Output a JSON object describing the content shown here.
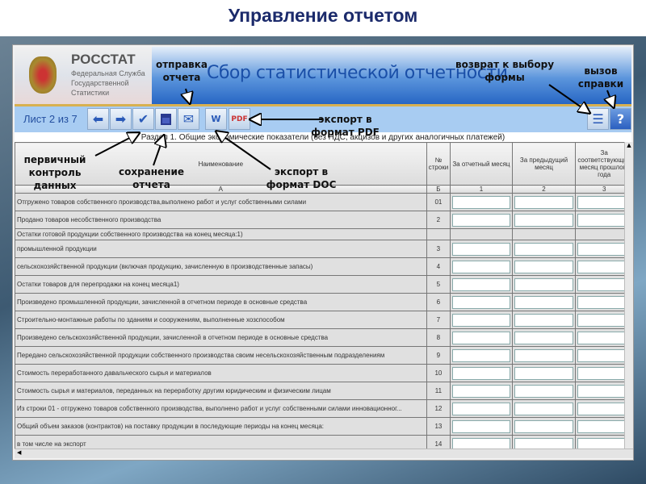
{
  "slide_title": "Управление отчетом",
  "logo": {
    "name": "РОССТАТ",
    "subtitle": "Федеральная Служба Государственной Статистики"
  },
  "app_title": "Сбор статистической отчетности",
  "toolbar": {
    "sheet": "Лист 2 из 7",
    "buttons": [
      "prev-arrow",
      "next-arrow",
      "check",
      "save",
      "mail",
      "export-doc",
      "export-pdf",
      "return-form",
      "help"
    ]
  },
  "section_title": "Раздел 1. Общие экономические показатели (без НДС, акцизов и других аналогичных платежей)",
  "table": {
    "headers": [
      "Наименование",
      "№ строки",
      "За отчетный месяц",
      "За предыдущий месяц",
      "За соответствующий месяц прошлого года"
    ],
    "codes": [
      "А",
      "Б",
      "1",
      "2",
      "3"
    ],
    "rows": [
      {
        "name": "Отгружено товаров собственного производства,выполнено работ и услуг собственными силами",
        "num": "01"
      },
      {
        "name": "Продано товаров несобственного производства",
        "num": "2"
      },
      {
        "name": "Остатки готовой продукции собственного производства на конец месяца:1)",
        "num": ""
      },
      {
        "name": "промышленной продукции",
        "num": "3"
      },
      {
        "name": "сельскохозяйственной продукции (включая продукцию, зачисленную в производственные запасы)",
        "num": "4"
      },
      {
        "name": "Остатки товаров для перепродажи на конец месяца1)",
        "num": "5"
      },
      {
        "name": "Произведено промышленной продукции, зачисленной в отчетном периоде в основные средства",
        "num": "6"
      },
      {
        "name": "Строительно-монтажные работы по зданиям и сооружениям, выполненные хозспособом",
        "num": "7"
      },
      {
        "name": "Произведено сельскохозяйственной продукции, зачисленной в отчетном периоде в основные средства",
        "num": "8"
      },
      {
        "name": "Передано сельскохозяйственной продукции собственного производства своим несельскохозяйственным подразделениям",
        "num": "9"
      },
      {
        "name": "Стоимость переработанного давальческого сырья и материалов",
        "num": "10"
      },
      {
        "name": "Стоимость сырья и материалов, переданных на переработку другим юридическим и физическим лицам",
        "num": "11"
      },
      {
        "name": "Из строки 01 - отгружено товаров собственного производства, выполнено работ и услуг собственными силами инновационног...",
        "num": "12"
      },
      {
        "name": "Общий объем заказов (контрактов) на поставку продукции в последующие периоды на конец месяца:",
        "num": "13"
      },
      {
        "name": "в том числе на экспорт",
        "num": "14"
      }
    ]
  },
  "annotations": {
    "send": "отправка отчета",
    "return": "возврат к выбору формы",
    "help": "вызов справки",
    "pdf": "экспорт в формат PDF",
    "check": "первичный контроль данных",
    "save": "сохранение отчета",
    "doc": "экспорт в формат DOC"
  }
}
